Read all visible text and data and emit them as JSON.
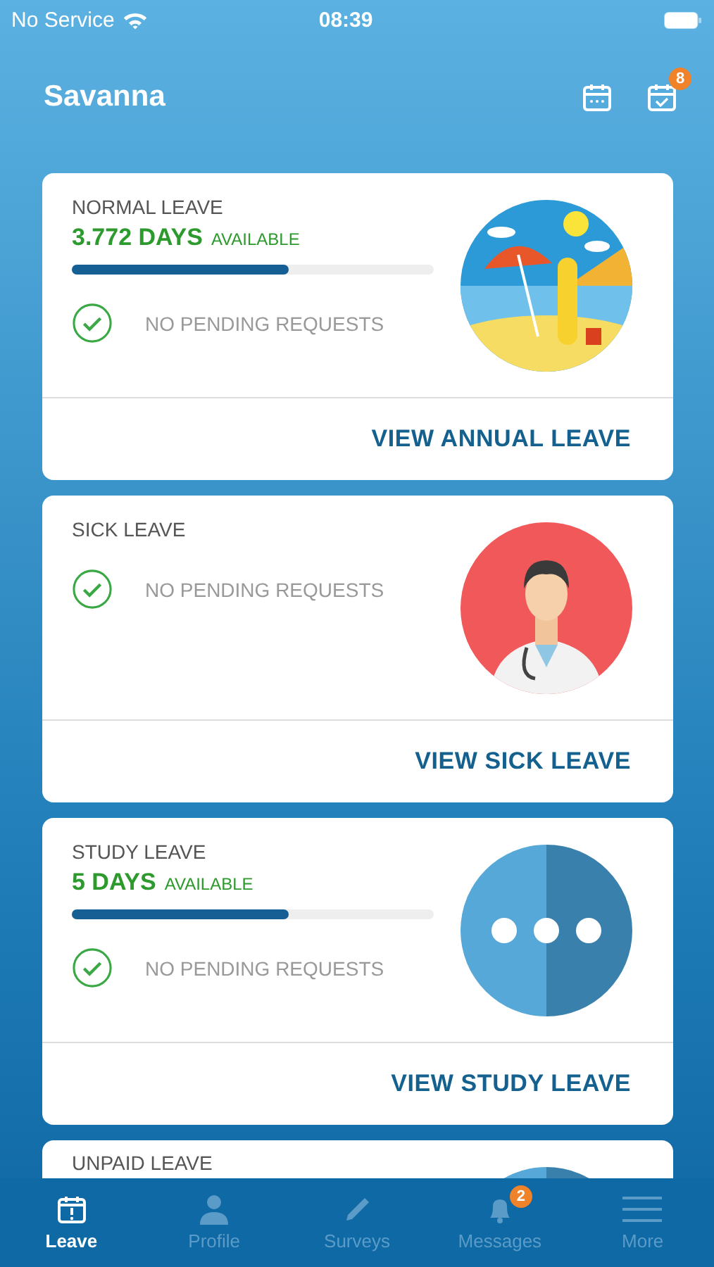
{
  "status_bar": {
    "carrier": "No Service",
    "time": "08:39"
  },
  "header": {
    "title": "Savanna",
    "tasks_badge": "8"
  },
  "cards": [
    {
      "title": "NORMAL LEAVE",
      "days": "3.772 DAYS",
      "available": "AVAILABLE",
      "level": 0.6,
      "pending": "NO PENDING REQUESTS",
      "action": "VIEW ANNUAL LEAVE"
    },
    {
      "title": "SICK LEAVE",
      "pending": "NO PENDING REQUESTS",
      "action": "VIEW SICK LEAVE"
    },
    {
      "title": "STUDY LEAVE",
      "days": "5 DAYS",
      "available": "AVAILABLE",
      "level": 0.6,
      "pending": "NO PENDING REQUESTS",
      "action": "VIEW STUDY LEAVE"
    },
    {
      "title": "UNPAID LEAVE"
    }
  ],
  "tabs": [
    {
      "label": "Leave",
      "selected": true
    },
    {
      "label": "Profile",
      "selected": false
    },
    {
      "label": "Surveys",
      "selected": false
    },
    {
      "label": "Messages",
      "selected": false,
      "badge": "2"
    },
    {
      "label": "More",
      "selected": false
    }
  ]
}
